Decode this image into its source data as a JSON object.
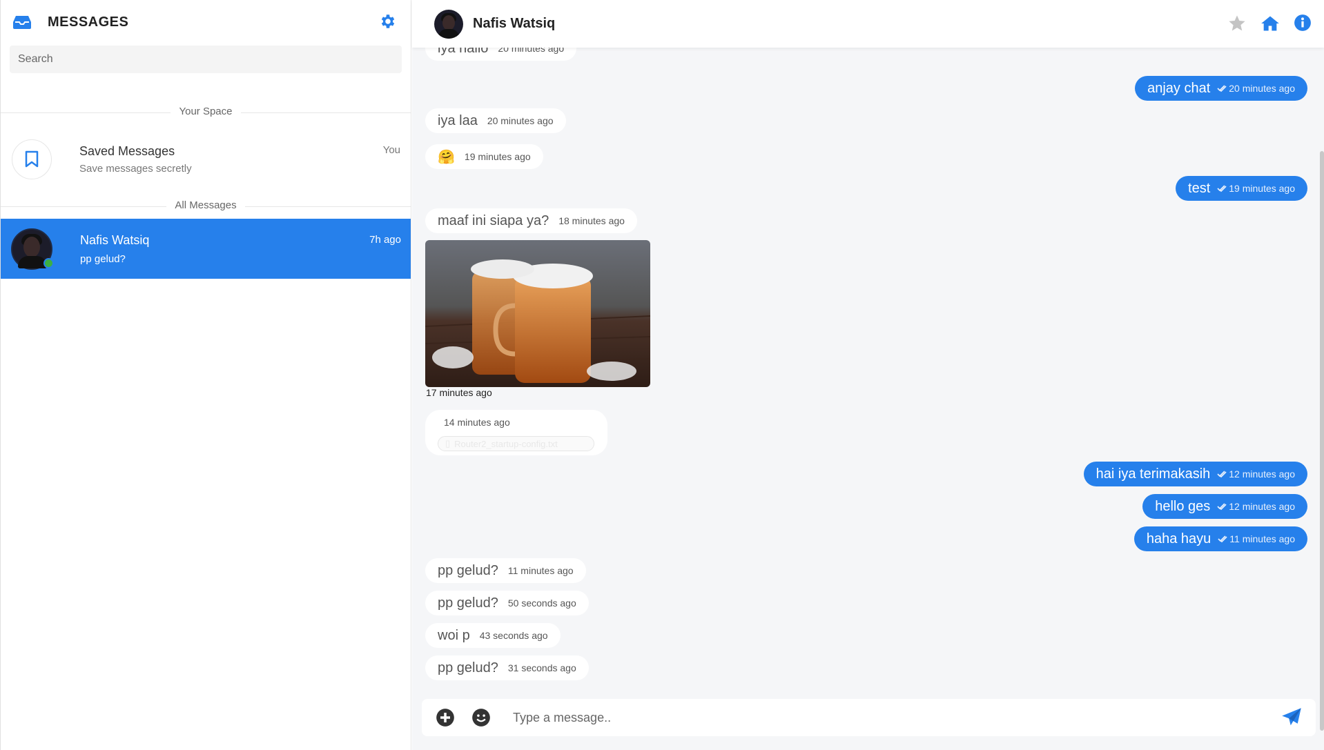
{
  "colors": {
    "accent": "#2680eb",
    "online": "#3cb043",
    "incoming_bg": "#ffffff",
    "chat_bg": "#f5f6f8"
  },
  "sidebar": {
    "title": "MESSAGES",
    "logo_icon": "inbox-icon",
    "settings_icon": "gear-icon",
    "search_placeholder": "Search",
    "section_your_space": "Your Space",
    "saved": {
      "name": "Saved Messages",
      "subtitle": "Save messages secretly",
      "right_label": "You",
      "icon": "bookmark-icon"
    },
    "section_all_messages": "All Messages",
    "contacts": [
      {
        "name": "Nafis Watsiq",
        "last_message": "pp gelud?",
        "time": "7h ago",
        "online": true,
        "selected": true
      }
    ]
  },
  "chat": {
    "contact_name": "Nafis Watsiq",
    "header_icons": [
      "star-icon",
      "home-icon",
      "info-icon"
    ],
    "messages": [
      {
        "dir": "in",
        "text": "iya hallo",
        "time": "20 minutes ago"
      },
      {
        "dir": "out",
        "text": "anjay chat",
        "time": "20 minutes ago"
      },
      {
        "dir": "in",
        "text": "iya laa",
        "time": "20 minutes ago"
      },
      {
        "dir": "in",
        "text": "🤗",
        "time": "19 minutes ago"
      },
      {
        "dir": "out",
        "text": "test",
        "time": "19 minutes ago"
      },
      {
        "dir": "in",
        "text": "maaf ini siapa ya?",
        "time": "18 minutes ago"
      },
      {
        "dir": "in",
        "type": "image",
        "alt": "iced tea jar",
        "time": "17 minutes ago"
      },
      {
        "dir": "in",
        "type": "file",
        "filename": "Router2_startup-config.txt",
        "time": "14 minutes ago"
      },
      {
        "dir": "out",
        "text": "hai iya terimakasih",
        "time": "12 minutes ago"
      },
      {
        "dir": "out",
        "text": "hello ges",
        "time": "12 minutes ago"
      },
      {
        "dir": "out",
        "text": "haha hayu",
        "time": "11 minutes ago"
      },
      {
        "dir": "in",
        "text": "pp gelud?",
        "time": "11 minutes ago"
      },
      {
        "dir": "in",
        "text": "pp gelud?",
        "time": "50 seconds ago"
      },
      {
        "dir": "in",
        "text": "woi p",
        "time": "43 seconds ago"
      },
      {
        "dir": "in",
        "text": "pp gelud?",
        "time": "31 seconds ago"
      }
    ],
    "input_placeholder": "Type a message..",
    "input_icons": [
      "plus-circle-icon",
      "smiley-icon",
      "send-icon"
    ]
  }
}
